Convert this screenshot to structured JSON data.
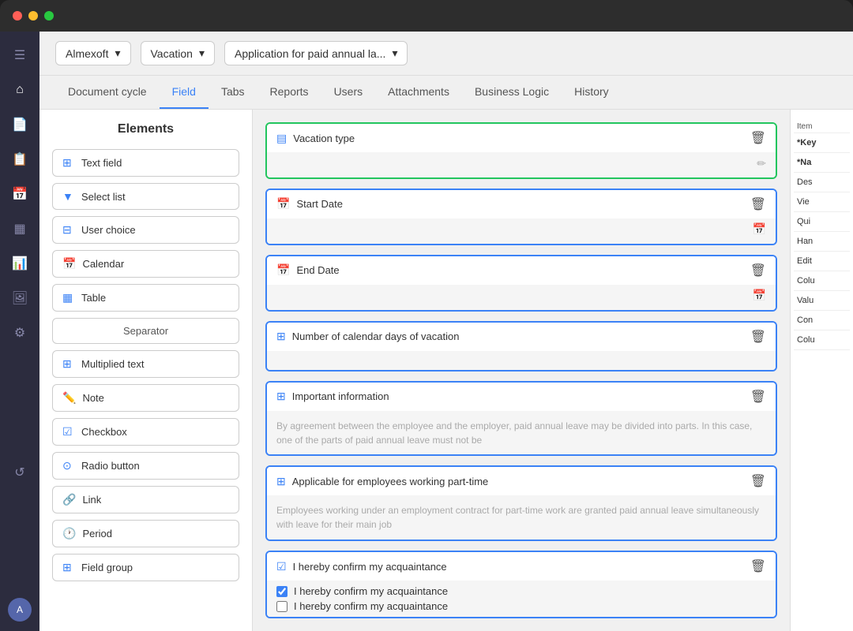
{
  "titlebar": {
    "buttons": [
      "red",
      "yellow",
      "green"
    ]
  },
  "topbar": {
    "dropdowns": [
      {
        "label": "Almexoft",
        "id": "company"
      },
      {
        "label": "Vacation",
        "id": "module"
      },
      {
        "label": "Application for paid annual la...",
        "id": "document"
      }
    ]
  },
  "tabs": [
    {
      "label": "Document cycle",
      "active": false
    },
    {
      "label": "Field",
      "active": true
    },
    {
      "label": "Tabs",
      "active": false
    },
    {
      "label": "Reports",
      "active": false
    },
    {
      "label": "Users",
      "active": false
    },
    {
      "label": "Attachments",
      "active": false
    },
    {
      "label": "Business Logic",
      "active": false
    },
    {
      "label": "History",
      "active": false
    }
  ],
  "elements": {
    "title": "Elements",
    "items": [
      {
        "label": "Text field",
        "icon": "⊞",
        "type": "text-field"
      },
      {
        "label": "Select list",
        "icon": "▼",
        "type": "select-list"
      },
      {
        "label": "User choice",
        "icon": "⊟",
        "type": "user-choice"
      },
      {
        "label": "Calendar",
        "icon": "📅",
        "type": "calendar"
      },
      {
        "label": "Table",
        "icon": "⊞",
        "type": "table"
      },
      {
        "label": "Separator",
        "icon": "",
        "type": "separator"
      },
      {
        "label": "Multiplied text",
        "icon": "⊞",
        "type": "multiplied-text"
      },
      {
        "label": "Note",
        "icon": "✏️",
        "type": "note"
      },
      {
        "label": "Checkbox",
        "icon": "☑",
        "type": "checkbox"
      },
      {
        "label": "Radio button",
        "icon": "⊙",
        "type": "radio-button"
      },
      {
        "label": "Link",
        "icon": "🔗",
        "type": "link"
      },
      {
        "label": "Period",
        "icon": "🕐",
        "type": "period"
      },
      {
        "label": "Field group",
        "icon": "⊞",
        "type": "field-group"
      }
    ]
  },
  "fields": [
    {
      "id": "vacation-type",
      "label": "Vacation type",
      "icon": "list",
      "border": "green",
      "bodyIcon": "edit"
    },
    {
      "id": "start-date",
      "label": "Start Date",
      "icon": "calendar",
      "border": "blue",
      "bodyIcon": "calendar"
    },
    {
      "id": "end-date",
      "label": "End Date",
      "icon": "calendar",
      "border": "blue",
      "bodyIcon": "calendar"
    },
    {
      "id": "calendar-days",
      "label": "Number of calendar days of vacation",
      "icon": "grid",
      "border": "blue",
      "bodyIcon": ""
    },
    {
      "id": "important-info",
      "label": "Important information",
      "icon": "grid",
      "border": "blue",
      "bodyText": "By agreement between the employee and the employer, paid annual leave may be divided into parts. In this case, one of the parts of paid annual leave must not be"
    },
    {
      "id": "applicable-part-time",
      "label": "Applicable for employees working part-time",
      "icon": "grid",
      "border": "blue",
      "bodyText": "Employees working under an employment contract for part-time work are granted paid annual leave simultaneously with leave for their main job"
    },
    {
      "id": "confirm-acquaintance",
      "label": "I hereby confirm my acquaintance",
      "icon": "checkbox",
      "border": "blue",
      "checkboxChecked": true,
      "checkboxLabel2": "I hereby confirm my acquaintance"
    }
  ],
  "properties": {
    "items": [
      {
        "label": "Item",
        "type": "label"
      },
      {
        "label": "*Key",
        "type": "required"
      },
      {
        "label": "*Na",
        "type": "required"
      },
      {
        "label": "Des",
        "type": "normal"
      },
      {
        "label": "Vie",
        "type": "normal"
      },
      {
        "label": "Qui",
        "type": "normal"
      },
      {
        "label": "Han",
        "type": "normal"
      },
      {
        "label": "Edit",
        "type": "normal"
      },
      {
        "label": "Colu",
        "type": "normal"
      },
      {
        "label": "Valu",
        "type": "normal"
      },
      {
        "label": "Con",
        "type": "normal"
      },
      {
        "label": "Colu",
        "type": "normal"
      }
    ]
  },
  "nav_icons": [
    "≡",
    "⌂",
    "📄",
    "📋",
    "📅",
    "📊",
    "📈",
    "⚙",
    "↺"
  ],
  "avatar_label": "A"
}
